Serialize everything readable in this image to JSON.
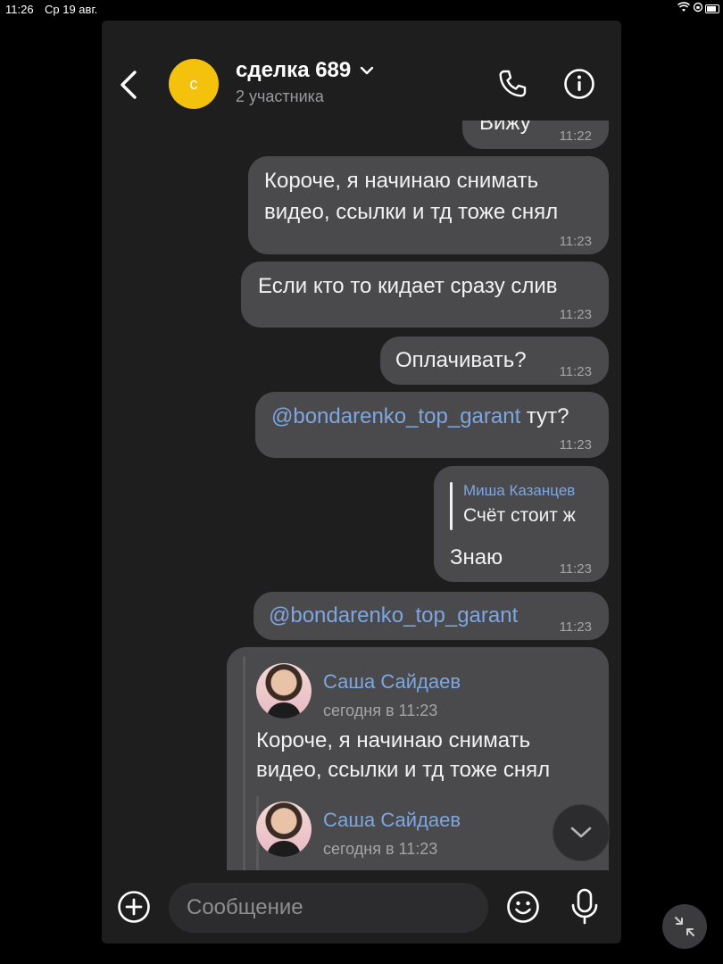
{
  "statusbar": {
    "time": "11:26",
    "date": "Ср 19 авг."
  },
  "header": {
    "avatar_letter": "с",
    "title": "сделка 689",
    "subtitle": "2 участника"
  },
  "messages": [
    {
      "text": "Вижу",
      "time": "11:22"
    },
    {
      "text_line1": "Короче, я начинаю снимать",
      "text_line2": "видео, ссылки и тд тоже снял",
      "time": "11:23"
    },
    {
      "text": "Если кто то кидает сразу слив",
      "time": "11:23"
    },
    {
      "text": "Оплачивать?",
      "time": "11:23"
    },
    {
      "mention": "@bondarenko_top_garant",
      "text": " тут?",
      "time": "11:23"
    },
    {
      "reply_author": "Миша Казанцев",
      "reply_text": "Счёт стоит ж",
      "text": "Знаю",
      "time": "11:23"
    },
    {
      "mention": "@bondarenko_top_garant",
      "time": "11:23"
    }
  ],
  "forwarded": [
    {
      "author": "Саша Сайдаев",
      "date": "сегодня в 11:23",
      "text_line1": "Короче, я начинаю снимать",
      "text_line2": "видео, ссылки и тд тоже снял"
    },
    {
      "author": "Саша Сайдаев",
      "date": "сегодня в 11:23"
    }
  ],
  "composer": {
    "placeholder": "Сообщение"
  },
  "icons": {
    "back": "chevron-left-icon",
    "call": "phone-icon",
    "info": "info-icon",
    "chevron": "chevron-down-icon",
    "attach": "plus-circle-icon",
    "emoji": "smile-icon",
    "mic": "microphone-icon",
    "scroll": "chevron-down-icon",
    "pip": "collapse-icon"
  },
  "colors": {
    "bubble": "#4a4a4c",
    "mention": "#7ea6e0",
    "avatar": "#f4c20d",
    "background": "#1e1e1f"
  }
}
